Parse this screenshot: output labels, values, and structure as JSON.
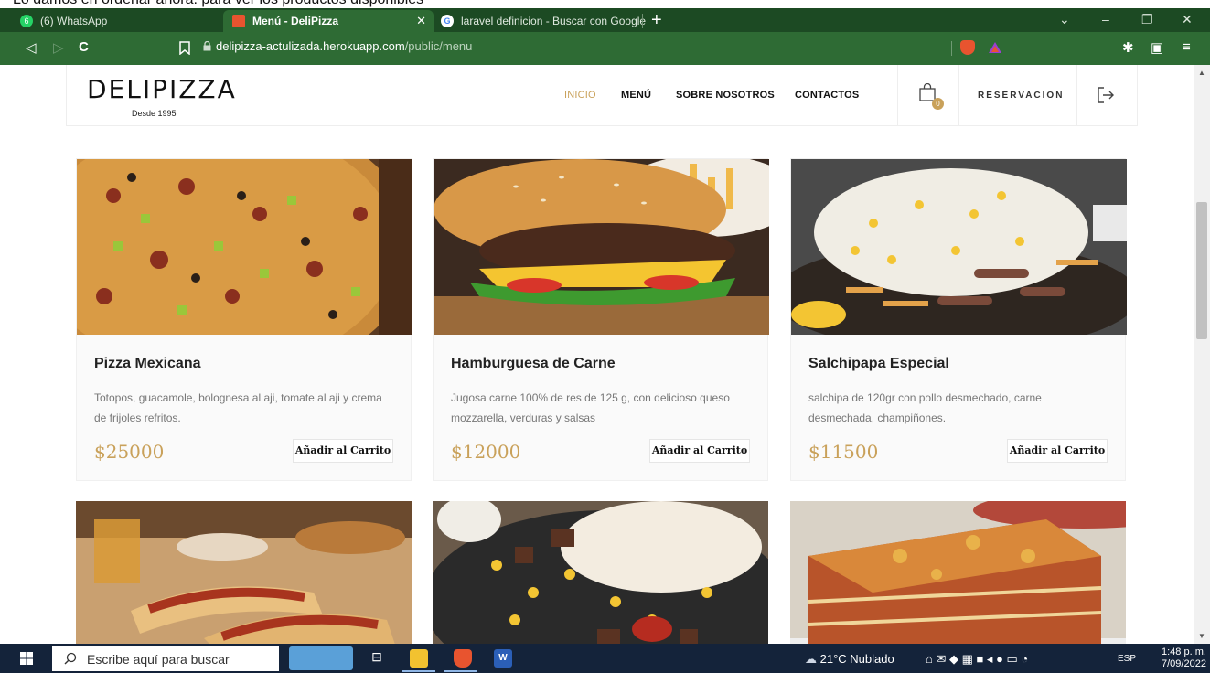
{
  "caption": "Lo damos en ordenar ahora: para ver los productos disponibles",
  "browser": {
    "tabs": [
      {
        "label": "(6) WhatsApp",
        "active": false
      },
      {
        "label": "Menú - DeliPizza",
        "active": true
      },
      {
        "label": "laravel definicion - Buscar con Google",
        "active": false
      }
    ],
    "url_domain": "delipizza-actulizada.herokuapp.com",
    "url_path": "/public/menu"
  },
  "site": {
    "logo": "DELIPIZZA",
    "logo_sub": "Desde 1995",
    "menu": [
      "INICIO",
      "MENÚ",
      "SOBRE NOSOTROS",
      "CONTACTOS"
    ],
    "cart_count": "0",
    "reservation": "RESERVACION"
  },
  "products": [
    {
      "name": "Pizza Mexicana",
      "desc": "Totopos, guacamole, bolognesa al aji, tomate al aji y crema de frijoles refritos.",
      "price": "$25000",
      "button": "Añadir al Carrito"
    },
    {
      "name": "Hamburguesa de Carne",
      "desc": "Jugosa carne 100% de res de 125 g, con delicioso queso mozzarella, verduras y salsas",
      "price": "$12000",
      "button": "Añadir al Carrito"
    },
    {
      "name": "Salchipapa Especial",
      "desc": "salchipa de 120gr con pollo desmechado, carne desmechada, champiñones.",
      "price": "$11500",
      "button": "Añadir al Carrito"
    }
  ],
  "taskbar": {
    "search_placeholder": "Escribe aquí para buscar",
    "weather": "21°C  Nublado",
    "lang": "ESP",
    "time": "1:48 p. m.",
    "date": "7/09/2022"
  }
}
